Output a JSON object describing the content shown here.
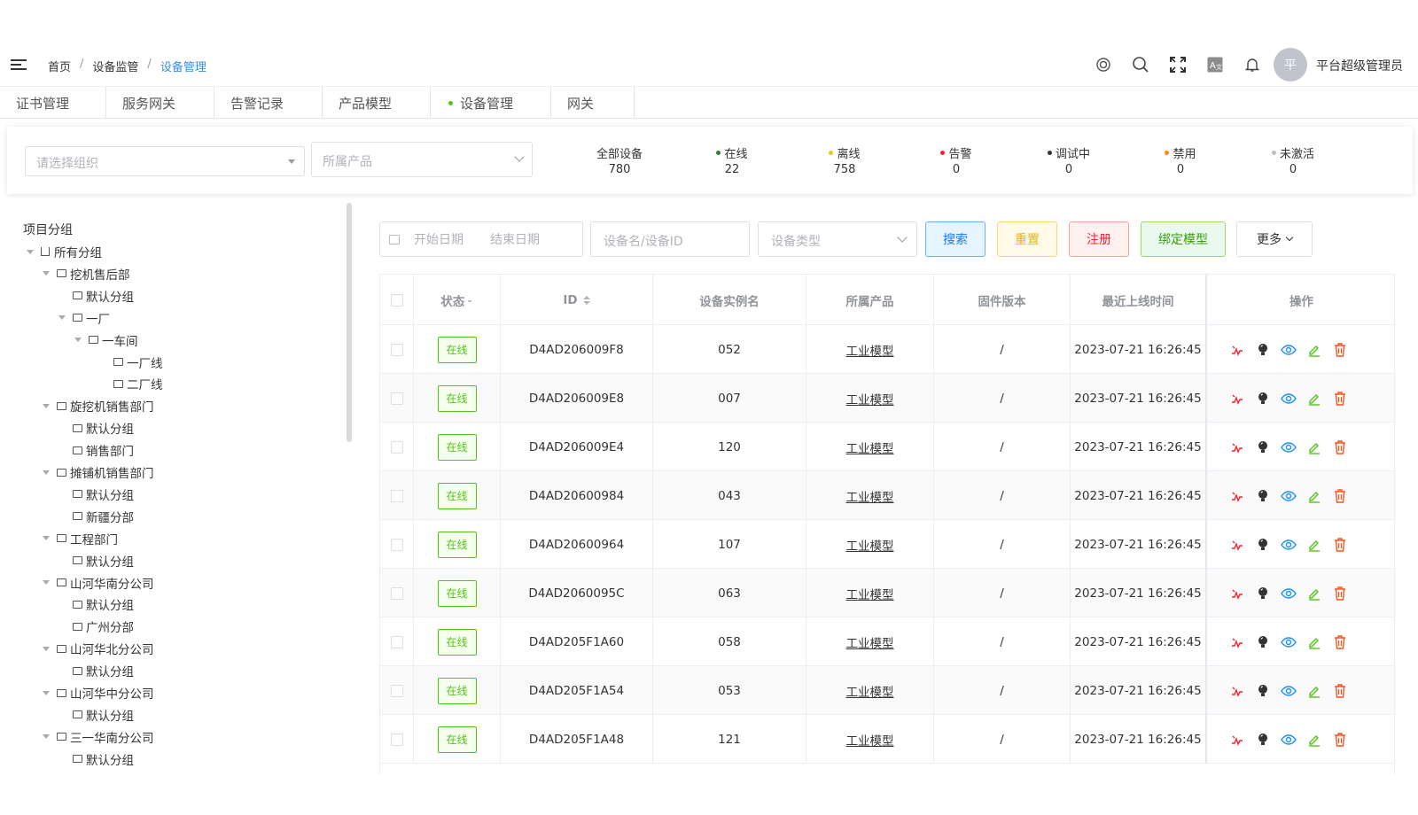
{
  "header": {
    "breadcrumb": [
      "首页",
      "设备监管",
      "设备管理"
    ],
    "avatar_letter": "平",
    "username": "平台超级管理员",
    "icons": [
      "theme-icon",
      "search-icon",
      "fullscreen-icon",
      "translate-icon",
      "bell-icon"
    ]
  },
  "tabs": [
    "证书管理",
    "服务网关",
    "告警记录",
    "产品模型",
    "设备管理",
    "网关"
  ],
  "active_tab": 4,
  "filters": {
    "org_placeholder": "请选择组织",
    "product_placeholder": "所属产品"
  },
  "stats": [
    {
      "label": "全部设备",
      "value": "780",
      "color": ""
    },
    {
      "label": "在线",
      "value": "22",
      "color": "#2e7d32"
    },
    {
      "label": "离线",
      "value": "758",
      "color": "#f5c518"
    },
    {
      "label": "告警",
      "value": "0",
      "color": "#f5222d"
    },
    {
      "label": "调试中",
      "value": "0",
      "color": "#333333"
    },
    {
      "label": "禁用",
      "value": "0",
      "color": "#fa8c16"
    },
    {
      "label": "未激活",
      "value": "0",
      "color": "#bfbfbf"
    }
  ],
  "sidebar": {
    "title": "项目分组",
    "tree": [
      {
        "label": "所有分组",
        "level": 0,
        "caret": true,
        "icon": "home"
      },
      {
        "label": "挖机售后部",
        "level": 1,
        "caret": true
      },
      {
        "label": "默认分组",
        "level": 2,
        "caret": false
      },
      {
        "label": "一厂",
        "level": 2,
        "caret": true
      },
      {
        "label": "一车间",
        "level": 3,
        "caret": true
      },
      {
        "label": "一厂线",
        "level": 4,
        "caret": false
      },
      {
        "label": "二厂线",
        "level": 4,
        "caret": false
      },
      {
        "label": "旋挖机销售部门",
        "level": 1,
        "caret": true
      },
      {
        "label": "默认分组",
        "level": 2,
        "caret": false
      },
      {
        "label": "销售部门",
        "level": 2,
        "caret": false
      },
      {
        "label": "摊铺机销售部门",
        "level": 1,
        "caret": true
      },
      {
        "label": "默认分组",
        "level": 2,
        "caret": false
      },
      {
        "label": "新疆分部",
        "level": 2,
        "caret": false
      },
      {
        "label": "工程部门",
        "level": 1,
        "caret": true
      },
      {
        "label": "默认分组",
        "level": 2,
        "caret": false
      },
      {
        "label": "山河华南分公司",
        "level": 1,
        "caret": true
      },
      {
        "label": "默认分组",
        "level": 2,
        "caret": false
      },
      {
        "label": "广州分部",
        "level": 2,
        "caret": false
      },
      {
        "label": "山河华北分公司",
        "level": 1,
        "caret": true
      },
      {
        "label": "默认分组",
        "level": 2,
        "caret": false
      },
      {
        "label": "山河华中分公司",
        "level": 1,
        "caret": true
      },
      {
        "label": "默认分组",
        "level": 2,
        "caret": false
      },
      {
        "label": "三一华南分公司",
        "level": 1,
        "caret": true
      },
      {
        "label": "默认分组",
        "level": 2,
        "caret": false
      }
    ]
  },
  "toolbar": {
    "start_date": "开始日期",
    "end_date": "结束日期",
    "device_search_placeholder": "设备名/设备ID",
    "device_type_placeholder": "设备类型",
    "search_label": "搜索",
    "reset_label": "重置",
    "register_label": "注册",
    "bind_model_label": "绑定模型",
    "more_label": "更多"
  },
  "table": {
    "columns": [
      "状态",
      "ID",
      "设备实例名",
      "所属产品",
      "固件版本",
      "最近上线时间",
      "操作"
    ],
    "rows": [
      {
        "status": "在线",
        "id": "D4AD206009F8",
        "name": "052",
        "product": "工业模型",
        "firmware": "/",
        "last_online": "2023-07-21 16:26:45"
      },
      {
        "status": "在线",
        "id": "D4AD206009E8",
        "name": "007",
        "product": "工业模型",
        "firmware": "/",
        "last_online": "2023-07-21 16:26:45"
      },
      {
        "status": "在线",
        "id": "D4AD206009E4",
        "name": "120",
        "product": "工业模型",
        "firmware": "/",
        "last_online": "2023-07-21 16:26:45"
      },
      {
        "status": "在线",
        "id": "D4AD20600984",
        "name": "043",
        "product": "工业模型",
        "firmware": "/",
        "last_online": "2023-07-21 16:26:45"
      },
      {
        "status": "在线",
        "id": "D4AD20600964",
        "name": "107",
        "product": "工业模型",
        "firmware": "/",
        "last_online": "2023-07-21 16:26:45"
      },
      {
        "status": "在线",
        "id": "D4AD2060095C",
        "name": "063",
        "product": "工业模型",
        "firmware": "/",
        "last_online": "2023-07-21 16:26:45"
      },
      {
        "status": "在线",
        "id": "D4AD205F1A60",
        "name": "058",
        "product": "工业模型",
        "firmware": "/",
        "last_online": "2023-07-21 16:26:45"
      },
      {
        "status": "在线",
        "id": "D4AD205F1A54",
        "name": "053",
        "product": "工业模型",
        "firmware": "/",
        "last_online": "2023-07-21 16:26:45"
      },
      {
        "status": "在线",
        "id": "D4AD205F1A48",
        "name": "121",
        "product": "工业模型",
        "firmware": "/",
        "last_online": "2023-07-21 16:26:45"
      }
    ],
    "row_actions": [
      "power-icon",
      "bulb-icon",
      "eye-icon",
      "edit-icon",
      "delete-icon"
    ]
  }
}
